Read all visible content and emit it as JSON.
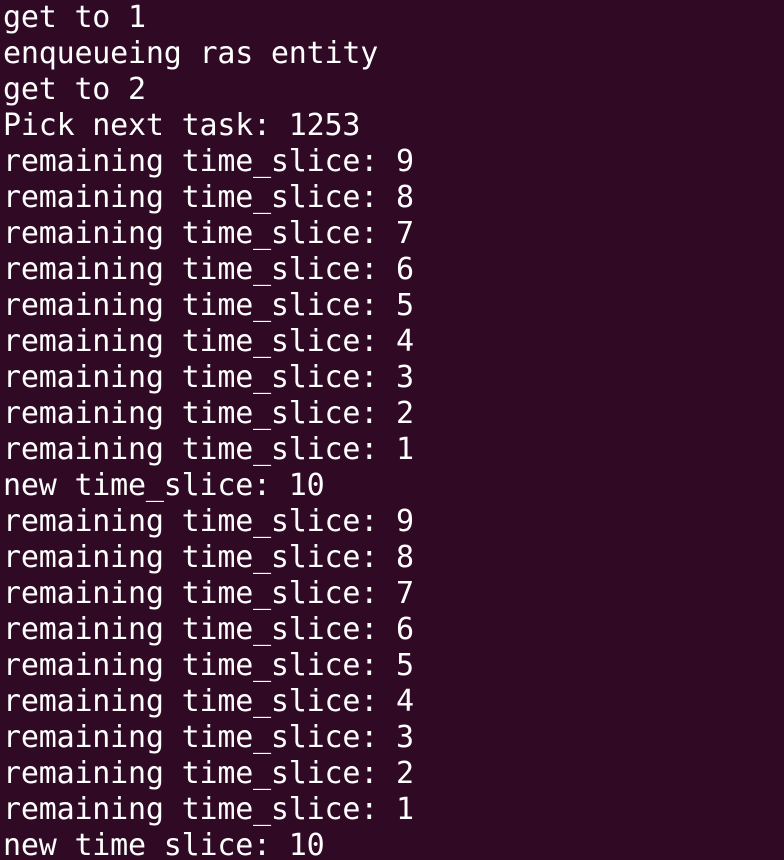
{
  "terminal": {
    "background": "#300a24",
    "foreground": "#ffffff",
    "lines": [
      "get to 1",
      "enqueueing ras entity",
      "get to 2",
      "Pick next task: 1253",
      "remaining time_slice: 9",
      "remaining time_slice: 8",
      "remaining time_slice: 7",
      "remaining time_slice: 6",
      "remaining time_slice: 5",
      "remaining time_slice: 4",
      "remaining time_slice: 3",
      "remaining time_slice: 2",
      "remaining time_slice: 1",
      "new time_slice: 10",
      "remaining time_slice: 9",
      "remaining time_slice: 8",
      "remaining time_slice: 7",
      "remaining time_slice: 6",
      "remaining time_slice: 5",
      "remaining time_slice: 4",
      "remaining time_slice: 3",
      "remaining time_slice: 2",
      "remaining time_slice: 1",
      "new time_slice: 10"
    ]
  }
}
